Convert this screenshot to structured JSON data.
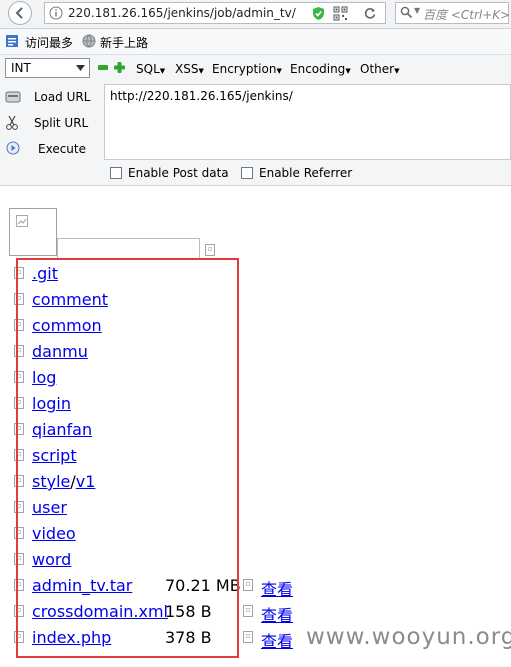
{
  "browser": {
    "url": "220.181.26.165/jenkins/job/admin_tv/",
    "search_placeholder": "百度 <Ctrl+K>"
  },
  "bookmarks": [
    {
      "label": "访问最多",
      "icon": "bookmark-icon"
    },
    {
      "label": "新手上路",
      "icon": "globe-icon"
    }
  ],
  "hackbar": {
    "type_select": "INT",
    "menus": [
      "SQL",
      "XSS",
      "Encryption",
      "Encoding",
      "Other"
    ],
    "actions": [
      {
        "label": "Load URL",
        "icon": "load-icon"
      },
      {
        "label": "Split URL",
        "icon": "scissors-icon"
      },
      {
        "label": "Execute",
        "icon": "execute-icon"
      }
    ],
    "url_value": "http://220.181.26.165/jenkins/",
    "enable_post_label": "Enable Post data",
    "enable_referrer_label": "Enable Referrer"
  },
  "listing": {
    "folders": [
      {
        "parts": [
          ".git"
        ]
      },
      {
        "parts": [
          "comment"
        ]
      },
      {
        "parts": [
          "common"
        ]
      },
      {
        "parts": [
          "danmu"
        ]
      },
      {
        "parts": [
          "log"
        ]
      },
      {
        "parts": [
          "login"
        ]
      },
      {
        "parts": [
          "qianfan"
        ]
      },
      {
        "parts": [
          "script"
        ]
      },
      {
        "parts": [
          "style",
          "v1"
        ]
      },
      {
        "parts": [
          "user"
        ]
      },
      {
        "parts": [
          "video"
        ]
      },
      {
        "parts": [
          "word"
        ]
      }
    ],
    "files": [
      {
        "name": "admin_tv.tar",
        "size": "70.21 MB",
        "view": "查看"
      },
      {
        "name": "crossdomain.xml",
        "size": "158 B",
        "view": "查看"
      },
      {
        "name": "index.php",
        "size": "378 B",
        "view": "查看"
      }
    ]
  },
  "watermark": "www.wooyun.org",
  "colors": {
    "link": "#0000ee",
    "highlight": "#e03c3c",
    "watermark": "#8b8b8b"
  }
}
